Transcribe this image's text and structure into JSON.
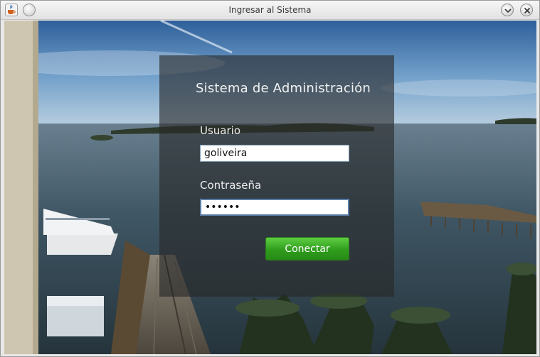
{
  "window": {
    "title": "Ingresar al Sistema",
    "app_icon": "java-cup-icon",
    "controls": [
      "minimize-icon",
      "close-icon"
    ]
  },
  "login": {
    "heading": "Sistema de Administración",
    "username_label": "Usuario",
    "username_value": "goliveira",
    "password_label": "Contraseña",
    "password_value": "••••••",
    "connect_label": "Conectar"
  },
  "colors": {
    "button": "#3aa823",
    "panel_overlay": "#282828",
    "input_border": "#7f9db9"
  }
}
